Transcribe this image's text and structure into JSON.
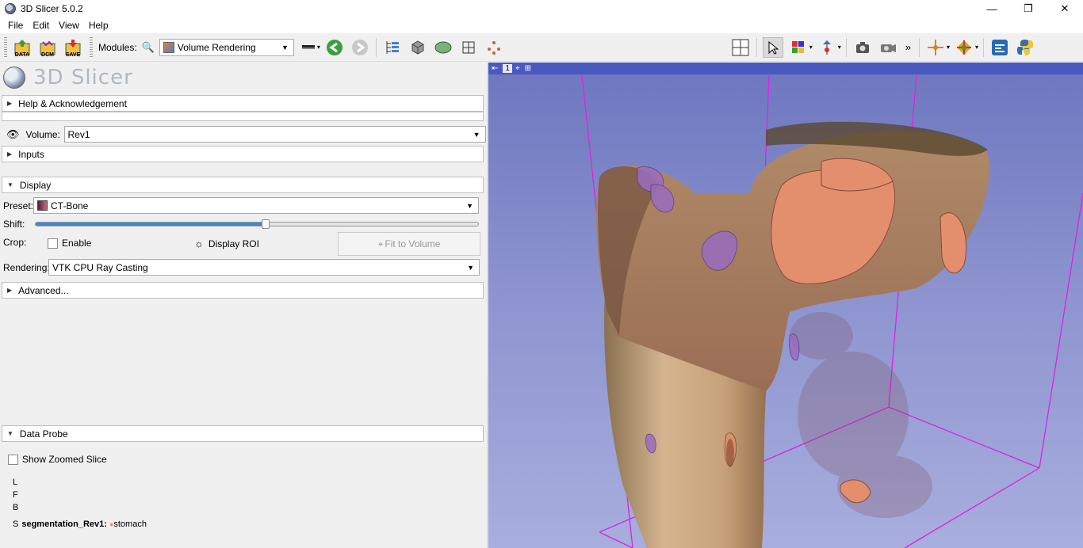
{
  "window": {
    "title": "3D Slicer 5.0.2",
    "controls": {
      "minimize": "—",
      "restore": "❐",
      "close": "✕"
    }
  },
  "menu": [
    "File",
    "Edit",
    "View",
    "Help"
  ],
  "toolbar": {
    "data_label": "DATA",
    "dcm_label": "DCM",
    "save_label": "SAVE",
    "modules_label": "Modules:",
    "module_selected": "Volume Rendering",
    "overflow": "»"
  },
  "panel": {
    "logo_text": "3D Slicer",
    "help_section": "Help & Acknowledgement",
    "volume_label": "Volume:",
    "volume_value": "Rev1",
    "inputs_section": "Inputs",
    "display_section": "Display",
    "preset_label": "Preset:",
    "preset_value": "CT-Bone",
    "shift_label": "Shift:",
    "shift_fraction": 0.52,
    "crop_label": "Crop:",
    "enable_label": "Enable",
    "display_roi_label": "Display ROI",
    "fit_to_volume_label": "Fit to Volume",
    "rendering_label": "Rendering:",
    "rendering_value": "VTK CPU Ray Casting",
    "advanced_section": "Advanced...",
    "data_probe_section": "Data Probe",
    "show_zoomed_slice_label": "Show Zoomed Slice",
    "probe_L": "L",
    "probe_F": "F",
    "probe_B": "B",
    "probe_S_prefix": "S",
    "probe_S_name": "segmentation_Rev1:",
    "probe_S_value": "stomach"
  },
  "view3d": {
    "view_number": "1",
    "box_color": "#e020e0",
    "bg_top": "#6f78c0",
    "bg_bottom": "#a8aedd"
  },
  "colors": {
    "accent": "#3e88d0",
    "bone": "#c9a77f",
    "soft_tissue": "#e38f6e",
    "highlight": "#9a6cc0"
  }
}
